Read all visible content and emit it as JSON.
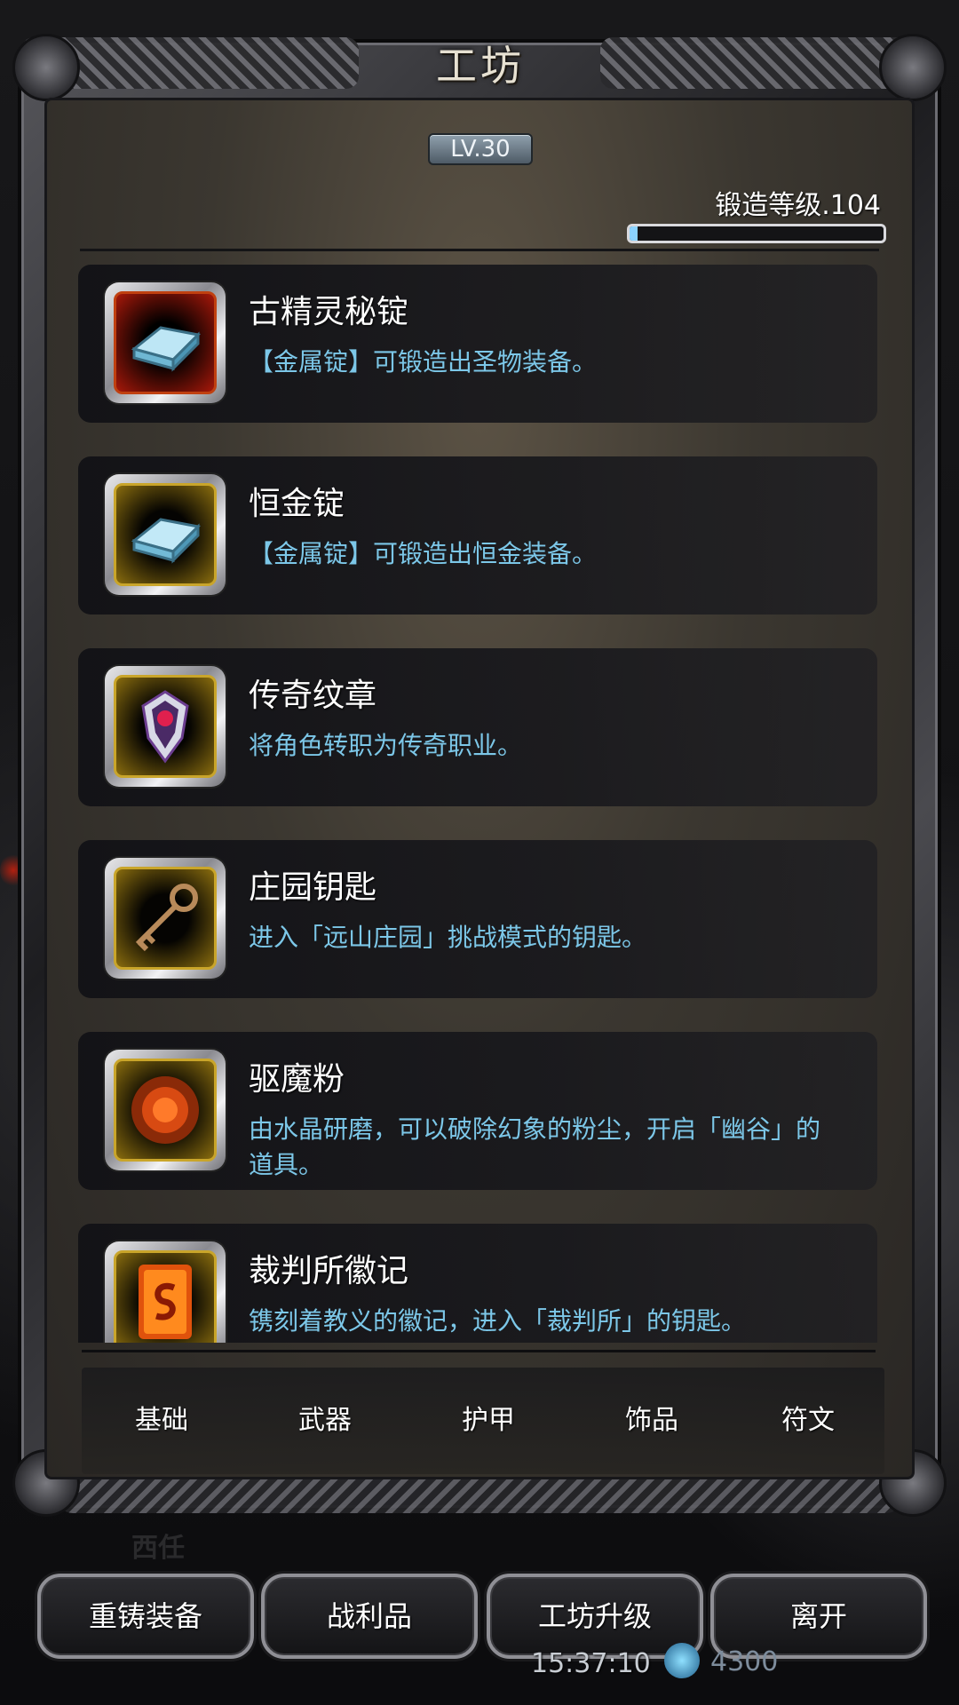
{
  "title": "工坊",
  "level_badge": "LV.30",
  "forge": {
    "label": "锻造等级.104",
    "progress": 0.03
  },
  "items": [
    {
      "title": "古精灵秘锭",
      "desc": "【金属锭】可锻造出圣物装备。",
      "icon": "ingot-icon",
      "frame": "red"
    },
    {
      "title": "恒金锭",
      "desc": "【金属锭】可锻造出恒金装备。",
      "icon": "ingot-icon",
      "frame": "gold"
    },
    {
      "title": "传奇纹章",
      "desc": "将角色转职为传奇职业。",
      "icon": "emblem-icon",
      "frame": "gold"
    },
    {
      "title": "庄园钥匙",
      "desc": "进入「远山庄园」挑战模式的钥匙。",
      "icon": "key-icon",
      "frame": "gold"
    },
    {
      "title": "驱魔粉",
      "desc": "由水晶研磨，可以破除幻象的粉尘，开启「幽谷」的道具。",
      "icon": "powder-icon",
      "frame": "gold"
    },
    {
      "title": "裁判所徽记",
      "desc": "镌刻着教义的徽记，进入「裁判所」的钥匙。",
      "icon": "seal-icon",
      "frame": "gold"
    }
  ],
  "tabs": [
    "基础",
    "武器",
    "护甲",
    "饰品",
    "符文"
  ],
  "active_tab": 0,
  "buttons": [
    "重铸装备",
    "战利品",
    "工坊升级",
    "离开"
  ],
  "status": {
    "time": "15:37:10",
    "gold": "4300"
  },
  "colors": {
    "desc_text": "#7cc7e8",
    "progress_fill": "#8bd3ff"
  }
}
